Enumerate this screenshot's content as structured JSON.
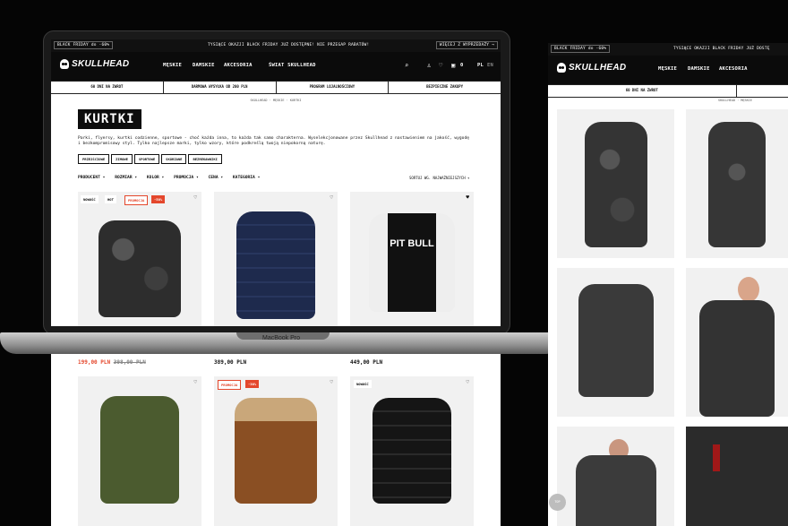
{
  "promo_bar": {
    "left": "BLACK FRIDAY do -60%",
    "center": "TYSIĄCE OKAZJI BLACK FRIDAY JUŻ DOSTĘPNE! NIE PRZEGAP RABATÓW!",
    "right": "WIĘCEJ Z WYPRZEDAŻY →",
    "right_panel": "BLACK FRIDAY do -60%",
    "right_center": "TYSIĄCE OKAZJI BLACK FRIDAY JUŻ DOSTĘ"
  },
  "brand": "SKULLHEAD",
  "nav": {
    "items": [
      "MĘSKIE",
      "DAMSKIE",
      "AKCESORIA",
      "ŚWIAT SKULLHEAD"
    ],
    "count": "0",
    "lang_pl": "PL",
    "lang_en": "EN"
  },
  "benefits": [
    "60 DNI NA ZWROT",
    "DARMOWA WYSYŁKA OD 200 PLN",
    "PROGRAM LOJALNOŚCIOWY",
    "BEZPIECZNE ZAKUPY"
  ],
  "breadcrumb": {
    "home": "SKULLHEAD",
    "men": "MĘSKIE",
    "current": "KURTKI"
  },
  "page": {
    "title": "KURTKI",
    "description": "Parki, flyersy, kurtki codzienne, sportowe - choć każda inna, to każda tak samo charakterna. Wyselekcjonowane przez Skullhead z nastawieniem na jakość, wygodę i bezkompromisowy styl. Tylko najlepsze marki, tylko wzory, które podkreślą twoją niepokorną naturę.",
    "chips": [
      "PRZEJŚCIOWE",
      "ZIMOWE",
      "SPORTOWE",
      "SKÓRZANE",
      "BEZREKAWNIKI"
    ]
  },
  "filters": {
    "items": [
      "PRODUCENT ▾",
      "ROZMIAR ▾",
      "KOLOR ▾",
      "PROMOCJA ▾",
      "CENA ▾",
      "KATEGORIA ▾"
    ],
    "sort": "SORTUJ WG. NAJWAŻNIEJSZYCH ▾"
  },
  "products": [
    {
      "tags": [
        "NOWOŚĆ",
        "HOT",
        "PROMOCJA",
        "-50%"
      ],
      "price": "199,00 PLN",
      "old_price": "398,00 PLN",
      "color": "camo"
    },
    {
      "tags": [],
      "price": "389,00 PLN",
      "color": "navy"
    },
    {
      "tags": [],
      "price": "449,00 PLN",
      "color": "varsity",
      "brand_text": "PIT BULL"
    },
    {
      "tags": [],
      "color": "olive"
    },
    {
      "tags": [
        "PROMOCJA",
        "-30%"
      ],
      "color": "brown"
    },
    {
      "tags": [
        "NOWOŚĆ"
      ],
      "color": "black"
    }
  ],
  "laptop_label": "MacBook Pro",
  "top_button": "TOP"
}
